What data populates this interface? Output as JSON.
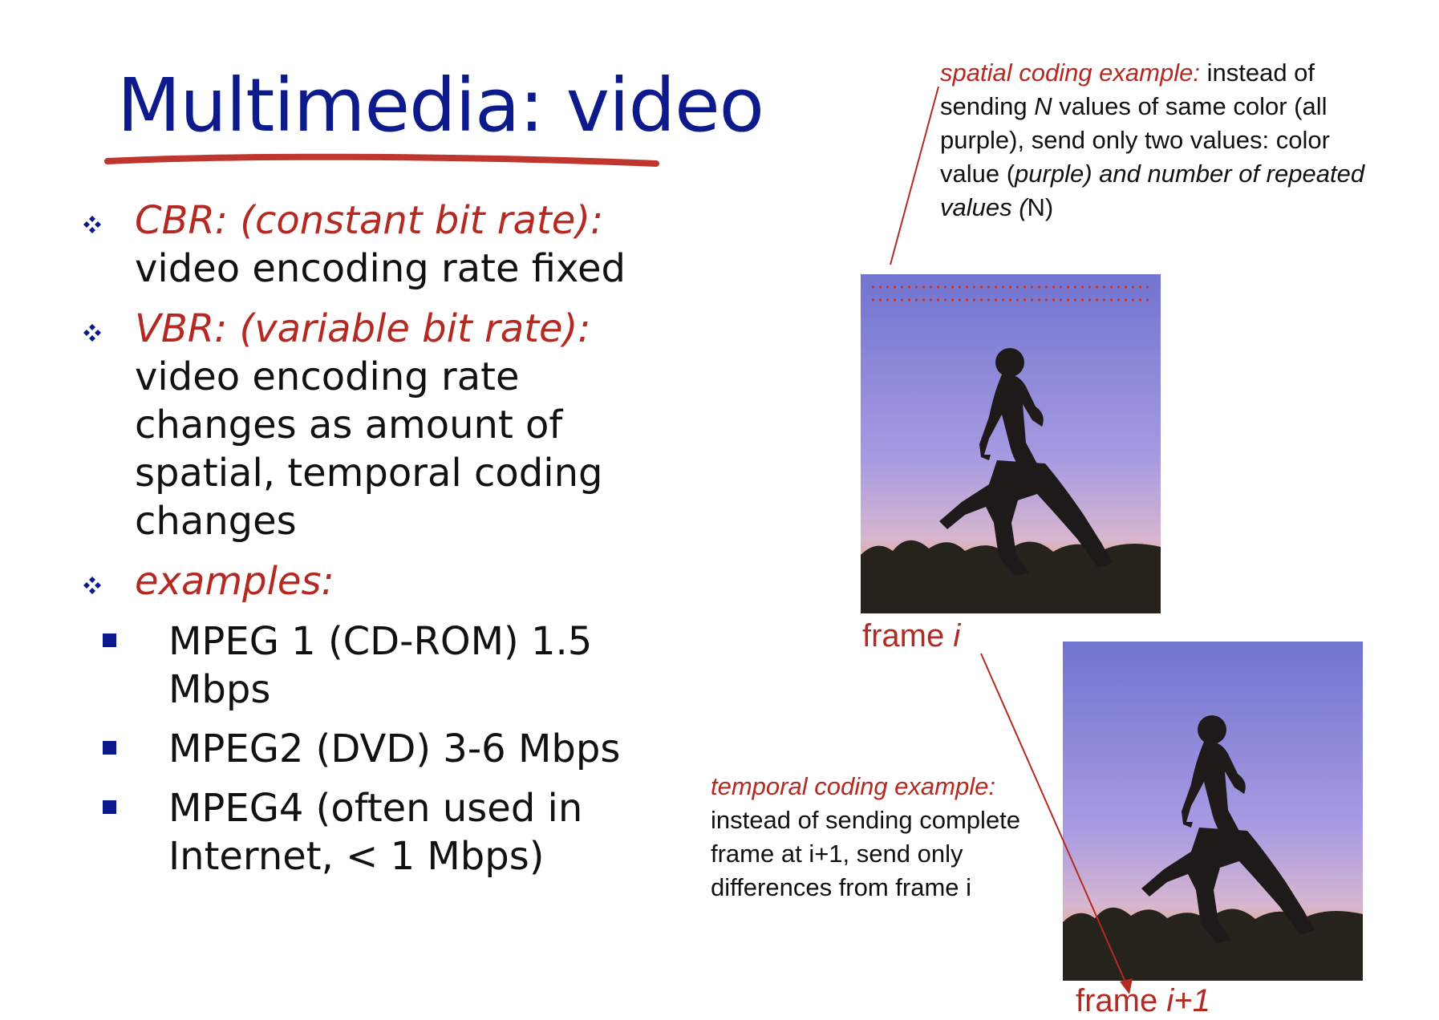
{
  "slide": {
    "title": "Multimedia: video",
    "colors": {
      "title": "#0d1a8c",
      "accent": "#b42a22",
      "text": "#111111",
      "sky_top": "#7d7fd6",
      "sky_mid": "#a79be0",
      "sky_horizon": "#e8a66e"
    },
    "bullets": [
      {
        "term": "CBR: (constant bit rate):",
        "text": " video encoding rate fixed"
      },
      {
        "term": "VBR:  (variable bit rate):",
        "text": " video encoding rate changes as amount of spatial, temporal coding changes"
      },
      {
        "term": "examples:",
        "text": ""
      }
    ],
    "examples": [
      "MPEG 1 (CD-ROM) 1.5 Mbps",
      "MPEG2 (DVD) 3-6 Mbps",
      "MPEG4 (often used in Internet, < 1 Mbps)"
    ],
    "spatial_note": {
      "lead": "spatial coding example:",
      "p1": " instead of sending ",
      "n1": "N",
      "p2": " values of same color (all purple), send only two values: color  value (",
      "purple": "purple)  and number of repeated values (",
      "n2": "N)"
    },
    "temporal_note": {
      "lead": "temporal coding example:",
      "body": "instead of sending complete frame at i+1, send only differences from frame i"
    },
    "frame_i": {
      "label_prefix": "frame ",
      "label_var": "i"
    },
    "frame_i1": {
      "label_prefix": "frame ",
      "label_var": "i+1"
    },
    "icons": {
      "bullet": "four-diamond-bullet-icon",
      "sub_bullet": "square-bullet-icon"
    }
  }
}
